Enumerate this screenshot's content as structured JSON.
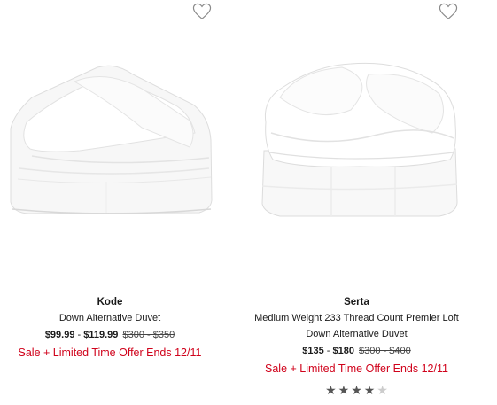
{
  "products": [
    {
      "brand": "Kode",
      "title_line1": "Down Alternative Duvet",
      "price_sale_low": "$99.99",
      "price_sep": " - ",
      "price_sale_high": "$119.99",
      "price_original": "$300 - $350",
      "promo": "Sale + Limited Time Offer Ends 12/11",
      "favorite_icon": "heart-outline-icon"
    },
    {
      "brand": "Serta",
      "title_line1": "Medium Weight 233 Thread Count Premier Loft",
      "title_line2": "Down Alternative Duvet",
      "price_sale_low": "$135",
      "price_sep": " - ",
      "price_sale_high": "$180",
      "price_original": "$300 - $400",
      "promo": "Sale + Limited Time Offer Ends 12/11",
      "favorite_icon": "heart-outline-icon",
      "rating": {
        "value": 4,
        "max": 5,
        "icon": "star-icon"
      }
    }
  ],
  "colors": {
    "promo": "#d0021b",
    "star_filled": "#555555",
    "star_empty": "#cccccc"
  }
}
